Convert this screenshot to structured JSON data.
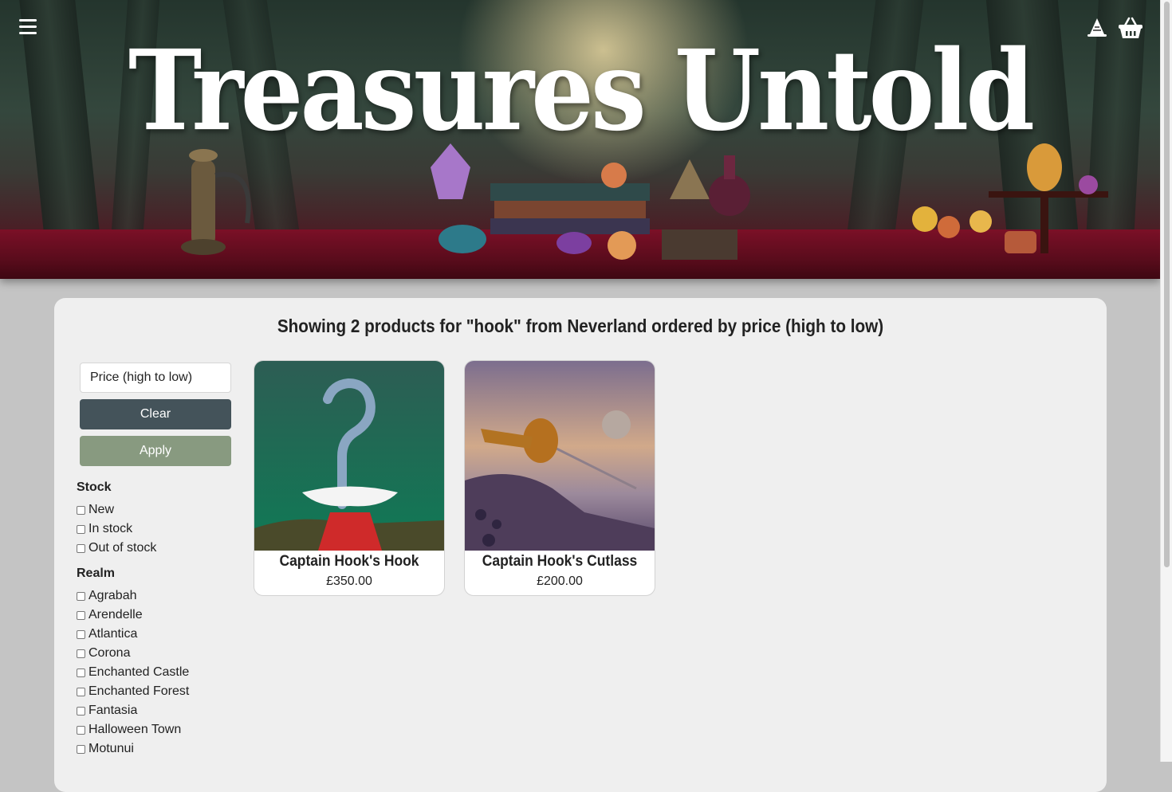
{
  "site": {
    "title": "Treasures Untold"
  },
  "header": {
    "menu_icon": "hamburger-menu-icon",
    "wizard_icon": "wizard-hat-icon",
    "basket_icon": "basket-icon"
  },
  "results": {
    "heading": "Showing 2 products for \"hook\" from Neverland ordered by price (high to low)"
  },
  "controls": {
    "sort_value": "Price (high to low)",
    "clear_label": "Clear",
    "apply_label": "Apply"
  },
  "filters": {
    "stock_heading": "Stock",
    "stock_options": [
      "New",
      "In stock",
      "Out of stock"
    ],
    "realm_heading": "Realm",
    "realm_options": [
      "Agrabah",
      "Arendelle",
      "Atlantica",
      "Corona",
      "Enchanted Castle",
      "Enchanted Forest",
      "Fantasia",
      "Halloween Town",
      "Motunui"
    ]
  },
  "products": [
    {
      "name": "Captain Hook's Hook",
      "price": "£350.00"
    },
    {
      "name": "Captain Hook's Cutlass",
      "price": "£200.00"
    }
  ],
  "colors": {
    "clear_button": "#44535a",
    "apply_button": "#889a80",
    "panel": "#efefef",
    "page_background": "#c4c4c4"
  }
}
